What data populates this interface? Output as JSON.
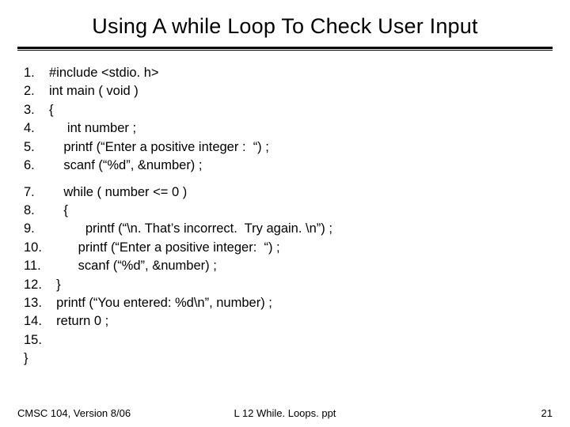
{
  "title": "Using  A while Loop To Check User Input",
  "code_block1": [
    {
      "n": "1.",
      "t": "#include <stdio. h>"
    },
    {
      "n": "2.",
      "t": "int main ( void )"
    },
    {
      "n": "3.",
      "t": "{"
    },
    {
      "n": "4.",
      "t": "     int number ;"
    },
    {
      "n": "5.",
      "t": "    printf (“Enter a positive integer :  “) ;"
    },
    {
      "n": "6.",
      "t": "    scanf (“%d”, &number) ;"
    }
  ],
  "code_block2": [
    {
      "n": "7.",
      "t": "    while ( number <= 0 )"
    },
    {
      "n": "8.",
      "t": "    {"
    },
    {
      "n": "9.",
      "t": "          printf (“\\n. That’s incorrect.  Try again. \\n”) ;"
    },
    {
      "n": "10.",
      "t": "        printf (“Enter a positive integer:  “) ;"
    },
    {
      "n": "11.",
      "t": "        scanf (“%d”, &number) ;"
    },
    {
      "n": "12.",
      "t": "  }"
    },
    {
      "n": "13.",
      "t": "  printf (“You entered: %d\\n”, number) ;"
    },
    {
      "n": "14.",
      "t": "  return 0 ;"
    },
    {
      "n": "15. }",
      "t": ""
    }
  ],
  "footer": {
    "left": "CMSC 104, Version 8/06",
    "center": "L 12 While. Loops. ppt",
    "right": "21"
  }
}
